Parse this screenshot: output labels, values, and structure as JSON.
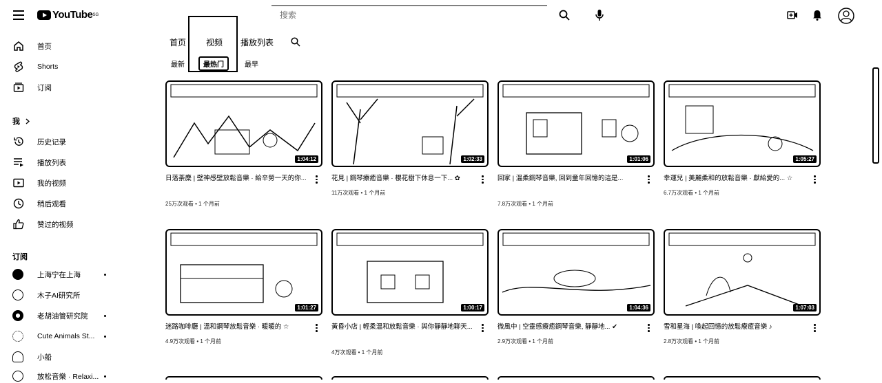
{
  "header": {
    "logo_text": "YouTube",
    "region": "SG",
    "search_placeholder": "搜索"
  },
  "sidebar": {
    "main": [
      {
        "label": "首页",
        "icon": "home-icon"
      },
      {
        "label": "Shorts",
        "icon": "shorts-icon"
      },
      {
        "label": "订阅",
        "icon": "subscriptions-icon"
      }
    ],
    "you_label": "我",
    "you_items": [
      {
        "label": "历史记录",
        "icon": "history-icon"
      },
      {
        "label": "播放列表",
        "icon": "playlist-icon"
      },
      {
        "label": "我的视频",
        "icon": "my-videos-icon"
      },
      {
        "label": "稍后观看",
        "icon": "watch-later-icon"
      },
      {
        "label": "赞过的视频",
        "icon": "like-icon"
      }
    ],
    "subs_label": "订阅",
    "subscriptions": [
      {
        "label": "上海宁在上海",
        "new": true
      },
      {
        "label": "木子AI研究所",
        "new": false
      },
      {
        "label": "老胡油管研究院",
        "new": true
      },
      {
        "label": "Cute Animals St...",
        "new": true
      },
      {
        "label": "小船",
        "new": false
      },
      {
        "label": "放松音樂 · Relaxi...",
        "new": true
      }
    ]
  },
  "tabs": [
    {
      "label": "首页"
    },
    {
      "label": "视频"
    },
    {
      "label": "播放列表"
    }
  ],
  "chips": [
    {
      "label": "最新"
    },
    {
      "label": "最热门"
    },
    {
      "label": "最早"
    }
  ],
  "videos": [
    {
      "title": "日落荼麋 | 壁神感壁放鬆音樂 · 給辛勞一天的你...",
      "meta": "25万次观看 • 1 个月前",
      "duration": "1:04:12"
    },
    {
      "title": "花見 | 鋼琴療癒音樂 · 櫻花樹下休息一下... ✿",
      "meta": "11万次观看 • 1 个月前",
      "duration": "1:02:33"
    },
    {
      "title": "回家 | 溫柔鋼琴音樂, 回到童年回憶的這是...",
      "meta": "7.8万次观看 • 1 个月前",
      "duration": "1:01:06"
    },
    {
      "title": "幸運兒 | 美麗柔和的放鬆音樂 · 獻給愛的... ☆",
      "meta": "6.7万次观看 • 1 个月前",
      "duration": "1:05:27"
    },
    {
      "title": "迷路咖啡廳 | 溫和鋼琴放鬆音樂 · 暖暖的 ☆",
      "meta": "4.9万次观看 • 1 个月前",
      "duration": "1:01:27"
    },
    {
      "title": "黃昏小店 | 輕柔溫和放鬆音樂 · 與你靜靜地聊天...",
      "meta": "4万次观看 • 1 个月前",
      "duration": "1:00:17"
    },
    {
      "title": "微風中 | 空靈感療癒鋼琴音樂, 靜靜地... ✔",
      "meta": "2.9万次观看 • 1 个月前",
      "duration": "1:04:36"
    },
    {
      "title": "雪和星海 | 喚起回憶的放鬆療癒音樂 ♪",
      "meta": "2.8万次观看 • 1 个月前",
      "duration": "1:07:03"
    }
  ]
}
